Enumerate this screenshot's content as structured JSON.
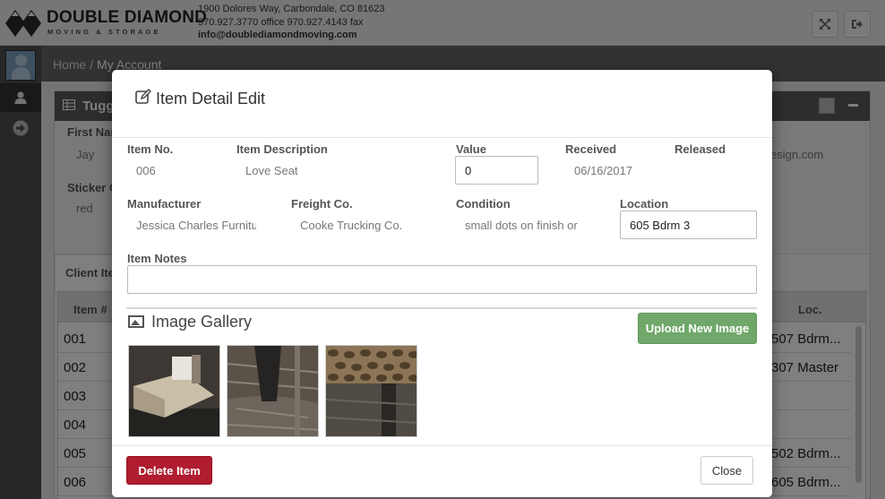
{
  "brand": {
    "name": "DOUBLE DIAMOND",
    "tagline": "MOVING & STORAGE"
  },
  "contact": {
    "address": "1900 Dolores Way, Carbondale, CO 81623",
    "phones": "970.927.3770 office 970.927.4143 fax",
    "email": "info@doublediamondmoving.com"
  },
  "header_buttons": [
    {
      "icon": "expand-icon"
    },
    {
      "icon": "sign-out-icon"
    }
  ],
  "sidebar": {
    "items": [
      {
        "icon": "user-icon"
      },
      {
        "icon": "arrow-right-circle-icon"
      }
    ]
  },
  "breadcrumb": {
    "home": "Home",
    "sep": "/",
    "current": "My Account"
  },
  "background_panel": {
    "title": "Tugg",
    "first_name_label": "First Nar",
    "first_name_value": "Jay",
    "sticker_label": "Sticker C",
    "sticker_value": "red",
    "email_partial": "esign.com",
    "tab_label": "Client Ite",
    "table": {
      "col_item": "Item #",
      "col_loc": "Loc.",
      "rows": [
        {
          "num": "001",
          "loc": "507 Bdrm..."
        },
        {
          "num": "002",
          "loc": "307 Master"
        },
        {
          "num": "003",
          "loc": ""
        },
        {
          "num": "004",
          "loc": ""
        },
        {
          "num": "005",
          "loc": "502 Bdrm..."
        },
        {
          "num": "006",
          "loc": "605 Bdrm..."
        }
      ]
    }
  },
  "modal": {
    "title": "Item Detail Edit",
    "fields": {
      "item_no": {
        "label": "Item No.",
        "value": "006"
      },
      "description": {
        "label": "Item Description",
        "value": "Love Seat"
      },
      "value": {
        "label": "Value",
        "value": "0"
      },
      "received": {
        "label": "Received",
        "value": "06/16/2017"
      },
      "released": {
        "label": "Released",
        "value": ""
      },
      "manufacturer": {
        "label": "Manufacturer",
        "value": "Jessica Charles Furniture"
      },
      "freight": {
        "label": "Freight Co.",
        "value": "Cooke Trucking Co."
      },
      "condition": {
        "label": "Condition",
        "value": "small dots on finish or"
      },
      "location": {
        "label": "Location",
        "value": "605 Bdrm 3"
      },
      "notes": {
        "label": "Item Notes",
        "value": ""
      }
    },
    "gallery_title": "Image Gallery",
    "upload_label": "Upload New Image",
    "delete_label": "Delete Item",
    "close_label": "Close"
  }
}
